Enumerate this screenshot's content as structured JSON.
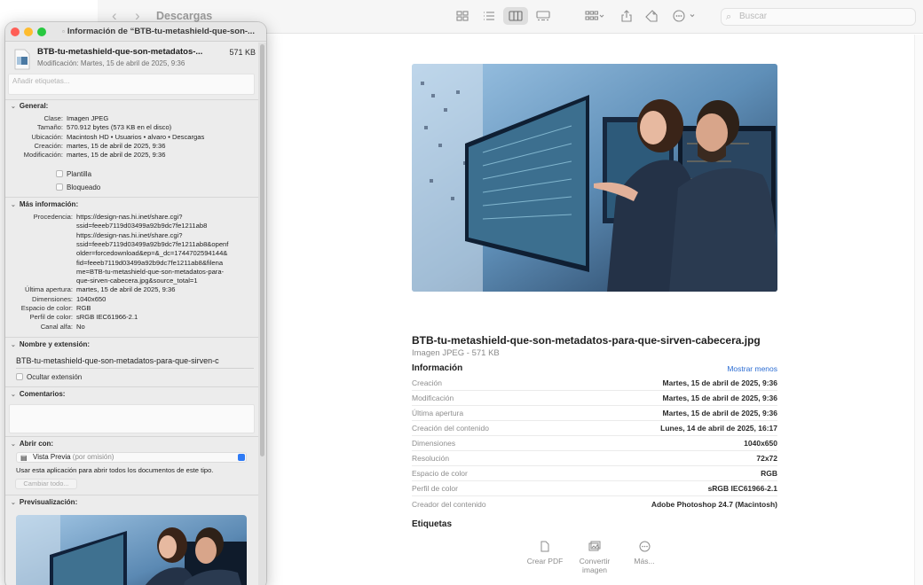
{
  "finder": {
    "folder_title": "Descargas",
    "search_placeholder": "Buscar",
    "preview": {
      "filename": "BTB-tu-metashield-que-son-metadatos-para-que-sirven-cabecera.jpg",
      "subtitle": "Imagen JPEG - 571 KB",
      "info_title": "Información",
      "show_less": "Mostrar menos",
      "rows": [
        {
          "k": "Creación",
          "v": "Martes, 15 de abril de 2025, 9:36"
        },
        {
          "k": "Modificación",
          "v": "Martes, 15 de abril de 2025, 9:36"
        },
        {
          "k": "Última apertura",
          "v": "Martes, 15 de abril de 2025, 9:36"
        },
        {
          "k": "Creación del contenido",
          "v": "Lunes, 14 de abril de 2025, 16:17"
        },
        {
          "k": "Dimensiones",
          "v": "1040x650"
        },
        {
          "k": "Resolución",
          "v": "72x72"
        },
        {
          "k": "Espacio de color",
          "v": "RGB"
        },
        {
          "k": "Perfil de color",
          "v": "sRGB IEC61966-2.1"
        },
        {
          "k": "Creador del contenido",
          "v": "Adobe Photoshop 24.7 (Macintosh)"
        }
      ],
      "tags_title": "Etiquetas",
      "actions": {
        "pdf": "Crear PDF",
        "convert_1": "Convertir",
        "convert_2": "imagen",
        "more": "Más..."
      }
    }
  },
  "info": {
    "window_title": "Información de “BTB-tu-metashield-que-son-...",
    "file_name": "BTB-tu-metashield-que-son-metadatos-...",
    "file_size": "571 KB",
    "modified": "Modificación: Martes, 15 de abril de 2025, 9:36",
    "tags_placeholder": "Añadir etiquetas...",
    "general": {
      "title": "General:",
      "rows": [
        {
          "k": "Clase:",
          "v": "Imagen JPEG"
        },
        {
          "k": "Tamaño:",
          "v": "570.912 bytes (573 KB en el disco)"
        },
        {
          "k": "Ubicación:",
          "v": "Macintosh HD • Usuarios • alvaro • Descargas"
        },
        {
          "k": "Creación:",
          "v": "martes, 15 de abril de 2025, 9:36"
        },
        {
          "k": "Modificación:",
          "v": "martes, 15 de abril de 2025, 9:36"
        }
      ],
      "template": "Plantilla",
      "locked": "Bloqueado"
    },
    "more_info": {
      "title": "Más información:",
      "source_label": "Procedencia:",
      "source_lines": [
        "https://design-nas.hi.inet/share.cgi?",
        "ssid=feeeb7119d03499a92b9dc7fe1211ab8",
        "https://design-nas.hi.inet/share.cgi?",
        "ssid=feeeb7119d03499a92b9dc7fe1211ab8&openf",
        "older=forcedownload&ep=&_dc=1744702594144&",
        "fid=feeeb7119d03499a92b9dc7fe1211ab8&filena",
        "me=BTB-tu-metashield-que-son-metadatos-para-",
        "que-sirven-cabecera.jpg&source_total=1"
      ],
      "rows": [
        {
          "k": "Última apertura:",
          "v": "martes, 15 de abril de 2025, 9:36"
        },
        {
          "k": "Dimensiones:",
          "v": "1040x650"
        },
        {
          "k": "Espacio de color:",
          "v": "RGB"
        },
        {
          "k": "Perfil de color:",
          "v": "sRGB IEC61966-2.1"
        },
        {
          "k": "Canal alfa:",
          "v": "No"
        }
      ]
    },
    "name_ext": {
      "title": "Nombre y extensión:",
      "value": "BTB-tu-metashield-que-son-metadatos-para-que-sirven-c",
      "hide_ext": "Ocultar extensión"
    },
    "comments_title": "Comentarios:",
    "open_with": {
      "title": "Abrir con:",
      "app": "Vista Previa",
      "app_sub": "(por omisión)",
      "use_text": "Usar esta aplicación para abrir todos los documentos de este tipo.",
      "change_all": "Cambiar todo..."
    },
    "preview_title": "Previsualización:"
  },
  "colors": {
    "accent": "#2c6dd3",
    "close": "#ff5f57",
    "minimize": "#febc2e",
    "zoom": "#28c840"
  }
}
